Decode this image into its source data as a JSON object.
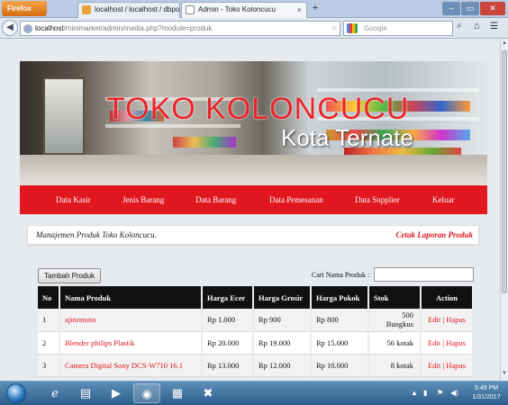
{
  "browser": {
    "menu_button": "Firefox",
    "tabs": [
      {
        "label": "localhost / localhost / dbpos | phpMy...",
        "close": "×"
      },
      {
        "label": "Admin - Toko Koloncucu",
        "close": "×"
      }
    ],
    "new_tab": "+",
    "back": "◀",
    "url_host": "localhost",
    "url_path": "/minimarket/admin/media.php?module=produk",
    "url_icons": "☆ ▾ C",
    "search_placeholder": "Google",
    "window_controls": [
      "–",
      "▭",
      "✕"
    ]
  },
  "banner": {
    "title": "TOKO KOLONCUCU",
    "subtitle": "Kota Ternate"
  },
  "menu": {
    "items": [
      "Data Kasir",
      "Jenis Barang",
      "Data Barang",
      "Data Pemesanan",
      "Data Supplier",
      "Keluar"
    ]
  },
  "panel": {
    "title": "Manajemen Produk Toko Koloncucu.",
    "print_link": "Cetak Laporan Produk"
  },
  "controls": {
    "add_button": "Tambah Produk",
    "search_label": "Cari Nama Produk :",
    "search_value": ""
  },
  "table": {
    "headers": [
      "No",
      "Nama Produk",
      "Harga Ecer",
      "Harga Grosir",
      "Harga Pokok",
      "Stok",
      "Action"
    ],
    "rows": [
      {
        "no": "1",
        "nama": "ajinomoto",
        "ecer": "Rp 1.000",
        "grosir": "Rp 900",
        "pokok": "Rp 800",
        "stok": "500 Bungkus",
        "edit": "Edit",
        "sep": "|",
        "hapus": "Hapus"
      },
      {
        "no": "2",
        "nama": "Blender philips Plastik",
        "ecer": "Rp 20.000",
        "grosir": "Rp 19.000",
        "pokok": "Rp 15.000",
        "stok": "56 kotak",
        "edit": "Edit",
        "sep": "|",
        "hapus": "Hapus"
      },
      {
        "no": "3",
        "nama": "Camera Digital Sony DCS-W710 16.1",
        "ecer": "Rp 13.000",
        "grosir": "Rp 12.000",
        "pokok": "Rp 10.000",
        "stok": "8 kotak",
        "edit": "Edit",
        "sep": "|",
        "hapus": "Hapus"
      }
    ]
  },
  "taskbar": {
    "time": "5:49 PM",
    "date": "1/31/2017"
  },
  "colors": {
    "menu_red": "#e0171f",
    "banner_title_red": "#e8252a",
    "table_header": "#111111",
    "link_red": "#e0171f"
  }
}
